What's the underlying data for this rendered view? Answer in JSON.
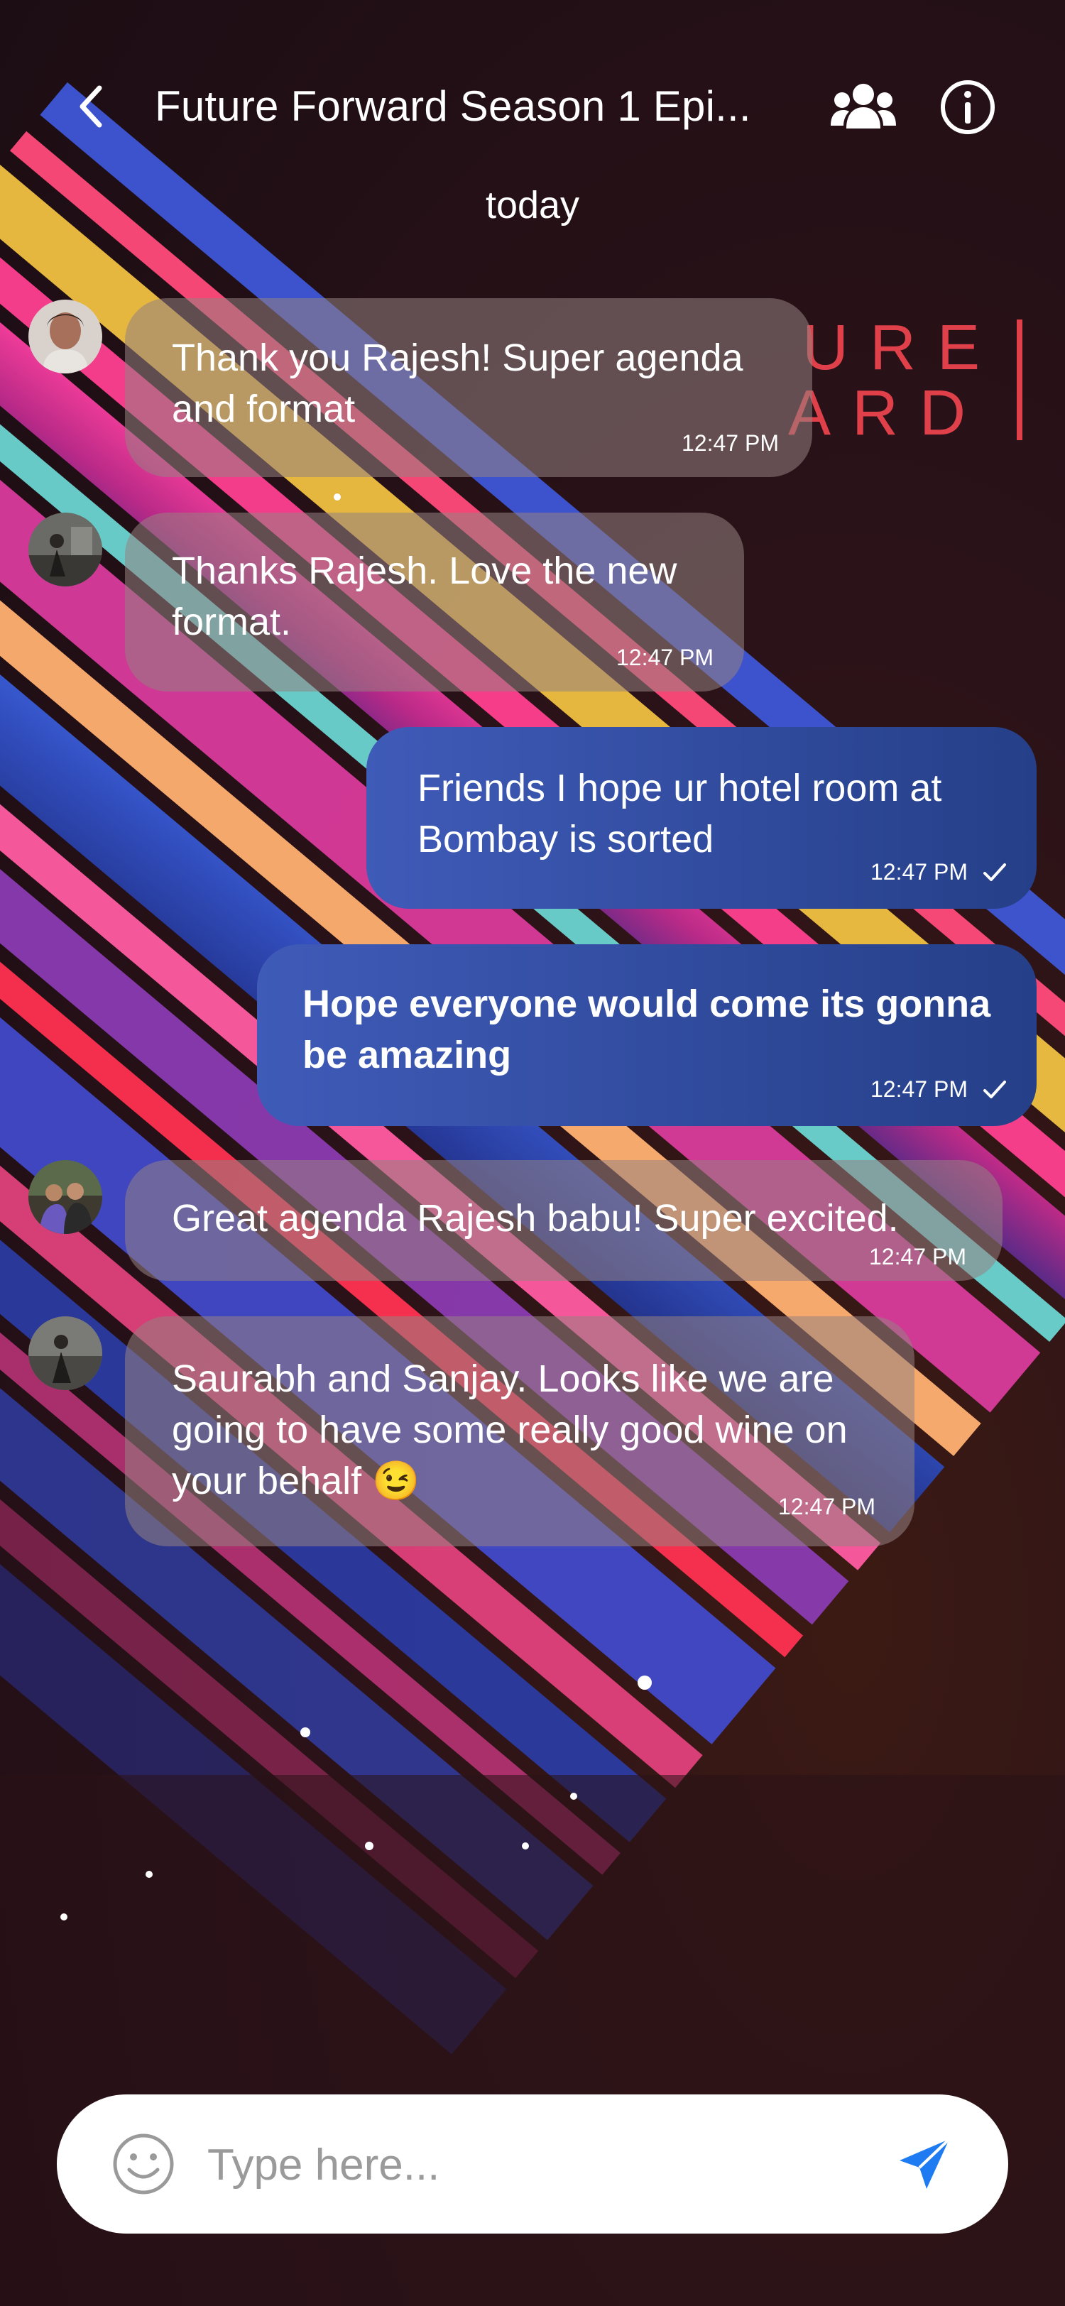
{
  "header": {
    "title": "Future Forward Season 1 Epi...",
    "back_icon": "chevron-left-icon",
    "group_icon": "group-icon",
    "info_icon": "info-icon"
  },
  "date_separator": "today",
  "background_poster_text": {
    "line1": "URE",
    "line2": "ARD"
  },
  "messages": [
    {
      "direction": "incoming",
      "text_line1": "Thank you Rajesh! Super agenda",
      "text_line2": "and format",
      "time": "12:47 PM"
    },
    {
      "direction": "incoming",
      "text_line1": "Thanks Rajesh. Love the new",
      "text_line2": "format.",
      "time": "12:47 PM"
    },
    {
      "direction": "outgoing",
      "text_line1": "Friends I hope ur hotel room at",
      "text_line2": "Bombay is sorted",
      "time": "12:47 PM",
      "status": "sent"
    },
    {
      "direction": "outgoing",
      "text_line1": "Hope everyone would come its gonna",
      "text_line2": "be amazing",
      "time": "12:47 PM",
      "status": "sent"
    },
    {
      "direction": "incoming",
      "text_line1": "Great agenda Rajesh babu! Super excited.",
      "time": "12:47 PM"
    },
    {
      "direction": "incoming",
      "text_line1": "Saurabh and Sanjay. Looks like we are",
      "text_line2": "going to have some really good wine on",
      "text_line3": "your behalf",
      "emoji": "😉",
      "time": "12:47 PM"
    }
  ],
  "input": {
    "placeholder": "Type here...",
    "value": "",
    "emoji_icon": "smiley-icon",
    "send_icon": "send-icon"
  },
  "colors": {
    "outgoing_bubble": "#2f4a9e",
    "incoming_bubble": "#8f7f80",
    "send_icon": "#1e7bf2",
    "poster_text": "#e0404a"
  }
}
